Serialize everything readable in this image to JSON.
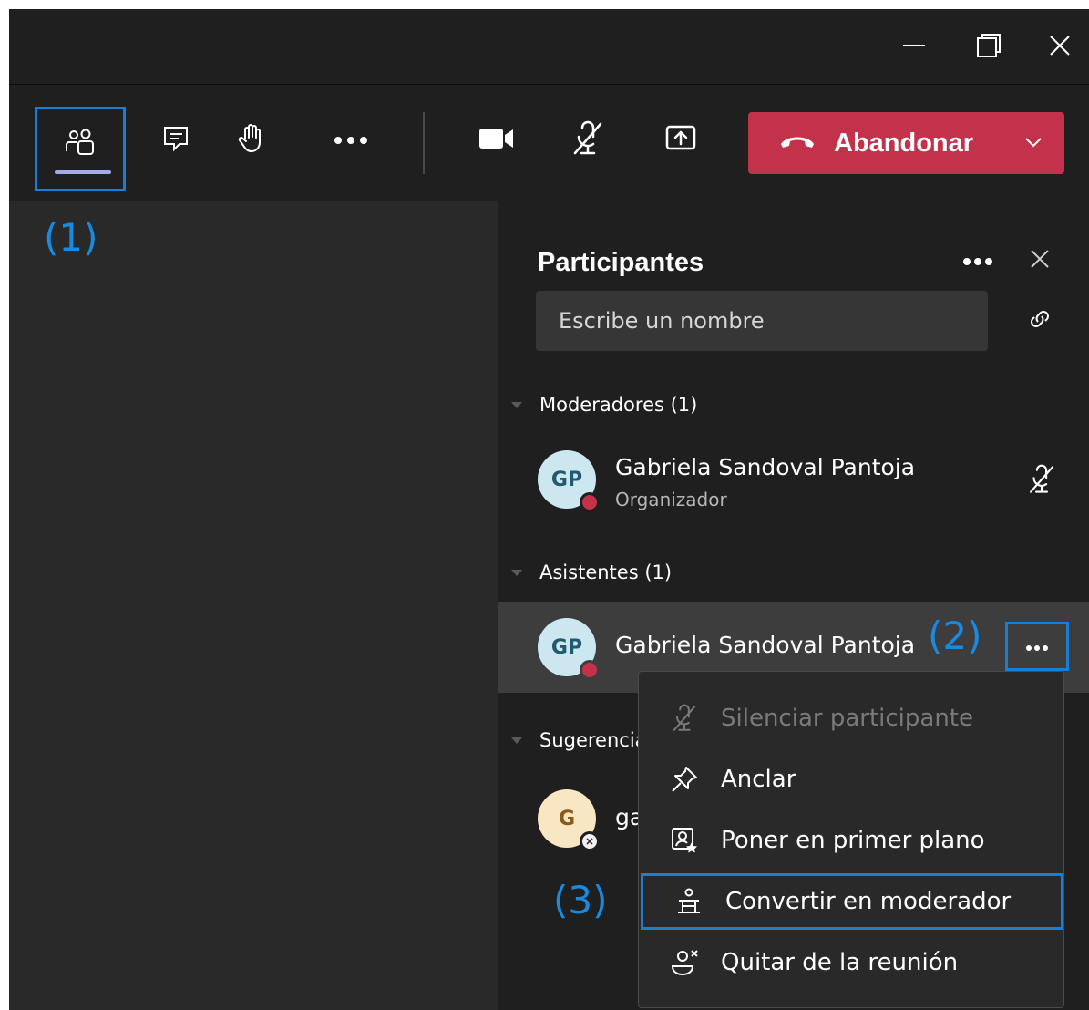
{
  "window": {
    "minimize_icon": "minimize-icon",
    "maximize_icon": "restore-icon",
    "close_icon": "close-icon"
  },
  "toolbar": {
    "people_icon": "people-icon",
    "chat_icon": "chat-icon",
    "hand_icon": "raise-hand-icon",
    "more_icon": "more-horizontal-icon",
    "camera_icon": "camera-icon",
    "mic_icon": "mic-off-icon",
    "share_icon": "share-screen-icon",
    "leave_label": "Abandonar",
    "leave_color": "#c4314b",
    "accent_color": "#1a7fd4"
  },
  "annotations": {
    "a1": "(1)",
    "a2": "(2)",
    "a3": "(3)"
  },
  "panel": {
    "title": "Participantes",
    "search_placeholder": "Escribe un nombre",
    "sections": {
      "moderators": "Moderadores (1)",
      "attendees": "Asistentes (1)",
      "suggestions": "Sugerencias"
    },
    "moderator": {
      "initials": "GP",
      "name": "Gabriela Sandoval Pantoja",
      "role": "Organizador"
    },
    "attendee": {
      "initials": "GP",
      "name": "Gabriela Sandoval Pantoja"
    },
    "suggestion": {
      "initials": "G",
      "name": "ga"
    }
  },
  "menu": {
    "items": [
      {
        "label": "Silenciar participante",
        "icon": "mic-off-icon",
        "disabled": true
      },
      {
        "label": "Anclar",
        "icon": "pin-icon",
        "disabled": false
      },
      {
        "label": "Poner en primer plano",
        "icon": "spotlight-icon",
        "disabled": false
      },
      {
        "label": "Convertir en moderador",
        "icon": "presenter-icon",
        "disabled": false
      },
      {
        "label": "Quitar de la reunión",
        "icon": "remove-person-icon",
        "disabled": false
      }
    ]
  }
}
